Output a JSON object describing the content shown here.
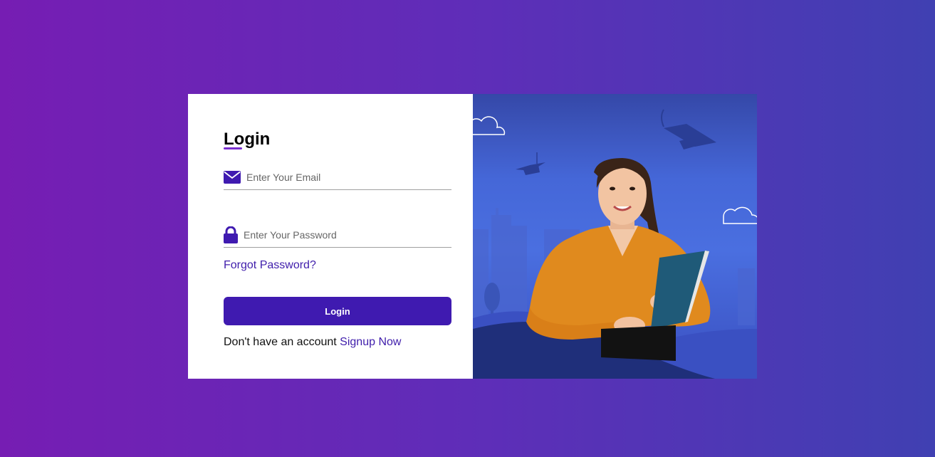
{
  "login": {
    "title": "Login",
    "email_placeholder": "Enter Your Email",
    "password_placeholder": "Enter Your Password",
    "forgot_password": "Forgot Password?",
    "login_button": "Login",
    "signup_prompt": "Don't have an account",
    "signup_link": "Signup Now"
  },
  "icons": {
    "email": "envelope-icon",
    "password": "lock-icon"
  },
  "colors": {
    "accent": "#3f1ab0",
    "link": "#3f1dab",
    "background_start": "#761db3",
    "background_end": "#4040b2"
  }
}
